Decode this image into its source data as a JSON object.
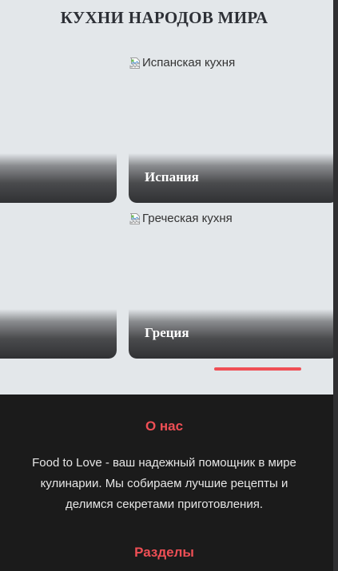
{
  "page": {
    "title": "КУХНИ НАРОДОВ МИРА"
  },
  "cards": [
    {
      "alt": "",
      "label": ""
    },
    {
      "alt": "Испанская кухня",
      "label": "Испания"
    },
    {
      "alt": "",
      "label": ""
    },
    {
      "alt": "Греческая кухня",
      "label": "Греция"
    }
  ],
  "footer": {
    "about_title": "О нас",
    "about_text": "Food to Love - ваш надежный помощник в мире кулинарии. Мы собираем лучшие рецепты и делимся секретами приготовления.",
    "sections_title": "Разделы"
  },
  "colors": {
    "background": "#e3e7ea",
    "accent": "#ef4f55",
    "footer_bg": "#1b1b1b"
  },
  "icons": {
    "broken_image": "broken-image-icon"
  }
}
